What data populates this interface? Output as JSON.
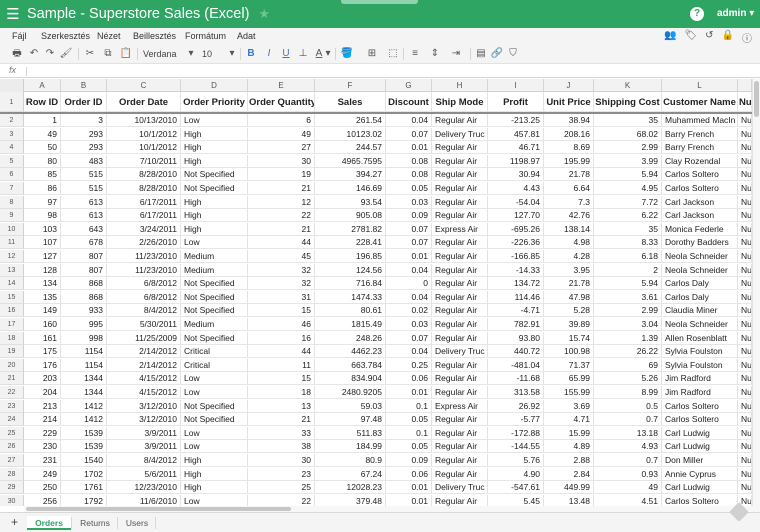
{
  "app": {
    "title": "Sample - Superstore Sales (Excel)",
    "user": "admin",
    "user_suffix": "▾",
    "accent_color": "#2fa564",
    "icons": {
      "menu": "☰",
      "star": "★",
      "help": "?"
    }
  },
  "menubar": {
    "items": [
      "Fájl",
      "Szerkesztés",
      "Nézet",
      "Beillesztés",
      "Formátum",
      "Adat"
    ],
    "right_icons": [
      "users-icon",
      "tag-icon",
      "history-icon",
      "lock-icon",
      "info-icon"
    ],
    "right_glyphs": [
      "👥",
      "🏷",
      "↺",
      "🔒",
      "ⓘ"
    ]
  },
  "toolbar": {
    "icons": {
      "print": "🖶",
      "undo": "↶",
      "redo": "↷",
      "paint_format": "🖌",
      "cut": "✂",
      "copy": "⧉",
      "paste": "📋",
      "font_color": "A",
      "fill_color": "🪣",
      "borders": "⊞",
      "merge": "⬚",
      "align": "≡",
      "valign": "⇕",
      "wrap": "⇥",
      "comment": "▤",
      "link": "🔗",
      "filter": "⛉"
    },
    "font_family": "Verdana",
    "font_size": "10",
    "dropdown_arrow": "▾",
    "bold_label": "B",
    "italic_label": "I",
    "underline_label": "U"
  },
  "formula_bar": {
    "label": "fx",
    "value": ""
  },
  "column_letters": [
    "A",
    "B",
    "C",
    "D",
    "E",
    "F",
    "G",
    "H",
    "I",
    "J",
    "K",
    "L"
  ],
  "table": {
    "headers": [
      "Row ID",
      "Order ID",
      "Order Date",
      "Order Priority",
      "Order Quantity",
      "Sales",
      "Discount",
      "Ship Mode",
      "Profit",
      "Unit Price",
      "Shipping Cost",
      "Customer Name",
      "Nu"
    ],
    "rows": [
      [
        "1",
        "3",
        "10/13/2010",
        "Low",
        "6",
        "261.54",
        "0.04",
        "Regular Air",
        "-213.25",
        "38.94",
        "35",
        "Muhammed MacIn",
        "Nu"
      ],
      [
        "49",
        "293",
        "10/1/2012",
        "High",
        "49",
        "10123.02",
        "0.07",
        "Delivery Truc",
        "457.81",
        "208.16",
        "68.02",
        "Barry French",
        "Nu"
      ],
      [
        "50",
        "293",
        "10/1/2012",
        "High",
        "27",
        "244.57",
        "0.01",
        "Regular Air",
        "46.71",
        "8.69",
        "2.99",
        "Barry French",
        "Nu"
      ],
      [
        "80",
        "483",
        "7/10/2011",
        "High",
        "30",
        "4965.7595",
        "0.08",
        "Regular Air",
        "1198.97",
        "195.99",
        "3.99",
        "Clay Rozendal",
        "Nu"
      ],
      [
        "85",
        "515",
        "8/28/2010",
        "Not Specified",
        "19",
        "394.27",
        "0.08",
        "Regular Air",
        "30.94",
        "21.78",
        "5.94",
        "Carlos Soltero",
        "Nu"
      ],
      [
        "86",
        "515",
        "8/28/2010",
        "Not Specified",
        "21",
        "146.69",
        "0.05",
        "Regular Air",
        "4.43",
        "6.64",
        "4.95",
        "Carlos Soltero",
        "Nu"
      ],
      [
        "97",
        "613",
        "6/17/2011",
        "High",
        "12",
        "93.54",
        "0.03",
        "Regular Air",
        "-54.04",
        "7.3",
        "7.72",
        "Carl Jackson",
        "Nu"
      ],
      [
        "98",
        "613",
        "6/17/2011",
        "High",
        "22",
        "905.08",
        "0.09",
        "Regular Air",
        "127.70",
        "42.76",
        "6.22",
        "Carl Jackson",
        "Nu"
      ],
      [
        "103",
        "643",
        "3/24/2011",
        "High",
        "21",
        "2781.82",
        "0.07",
        "Express Air",
        "-695.26",
        "138.14",
        "35",
        "Monica Federle",
        "Nu"
      ],
      [
        "107",
        "678",
        "2/26/2010",
        "Low",
        "44",
        "228.41",
        "0.07",
        "Regular Air",
        "-226.36",
        "4.98",
        "8.33",
        "Dorothy Badders",
        "Nu"
      ],
      [
        "127",
        "807",
        "11/23/2010",
        "Medium",
        "45",
        "196.85",
        "0.01",
        "Regular Air",
        "-166.85",
        "4.28",
        "6.18",
        "Neola Schneider",
        "Nu"
      ],
      [
        "128",
        "807",
        "11/23/2010",
        "Medium",
        "32",
        "124.56",
        "0.04",
        "Regular Air",
        "-14.33",
        "3.95",
        "2",
        "Neola Schneider",
        "Nu"
      ],
      [
        "134",
        "868",
        "6/8/2012",
        "Not Specified",
        "32",
        "716.84",
        "0",
        "Regular Air",
        "134.72",
        "21.78",
        "5.94",
        "Carlos Daly",
        "Nu"
      ],
      [
        "135",
        "868",
        "6/8/2012",
        "Not Specified",
        "31",
        "1474.33",
        "0.04",
        "Regular Air",
        "114.46",
        "47.98",
        "3.61",
        "Carlos Daly",
        "Nu"
      ],
      [
        "149",
        "933",
        "8/4/2012",
        "Not Specified",
        "15",
        "80.61",
        "0.02",
        "Regular Air",
        "-4.71",
        "5.28",
        "2.99",
        "Claudia Miner",
        "Nu"
      ],
      [
        "160",
        "995",
        "5/30/2011",
        "Medium",
        "46",
        "1815.49",
        "0.03",
        "Regular Air",
        "782.91",
        "39.89",
        "3.04",
        "Neola Schneider",
        "Nu"
      ],
      [
        "161",
        "998",
        "11/25/2009",
        "Not Specified",
        "16",
        "248.26",
        "0.07",
        "Regular Air",
        "93.80",
        "15.74",
        "1.39",
        "Allen Rosenblatt",
        "Nu"
      ],
      [
        "175",
        "1154",
        "2/14/2012",
        "Critical",
        "44",
        "4462.23",
        "0.04",
        "Delivery Truc",
        "440.72",
        "100.98",
        "26.22",
        "Sylvia Foulston",
        "Nu"
      ],
      [
        "176",
        "1154",
        "2/14/2012",
        "Critical",
        "11",
        "663.784",
        "0.25",
        "Regular Air",
        "-481.04",
        "71.37",
        "69",
        "Sylvia Foulston",
        "Nu"
      ],
      [
        "203",
        "1344",
        "4/15/2012",
        "Low",
        "15",
        "834.904",
        "0.06",
        "Regular Air",
        "-11.68",
        "65.99",
        "5.26",
        "Jim Radford",
        "Nu"
      ],
      [
        "204",
        "1344",
        "4/15/2012",
        "Low",
        "18",
        "2480.9205",
        "0.01",
        "Regular Air",
        "313.58",
        "155.99",
        "8.99",
        "Jim Radford",
        "Nu"
      ],
      [
        "213",
        "1412",
        "3/12/2010",
        "Not Specified",
        "13",
        "59.03",
        "0.1",
        "Express Air",
        "26.92",
        "3.69",
        "0.5",
        "Carlos Soltero",
        "Nu"
      ],
      [
        "214",
        "1412",
        "3/12/2010",
        "Not Specified",
        "21",
        "97.48",
        "0.05",
        "Regular Air",
        "-5.77",
        "4.71",
        "0.7",
        "Carlos Soltero",
        "Nu"
      ],
      [
        "229",
        "1539",
        "3/9/2011",
        "Low",
        "33",
        "511.83",
        "0.1",
        "Regular Air",
        "-172.88",
        "15.99",
        "13.18",
        "Carl Ludwig",
        "Nu"
      ],
      [
        "230",
        "1539",
        "3/9/2011",
        "Low",
        "38",
        "184.99",
        "0.05",
        "Regular Air",
        "-144.55",
        "4.89",
        "4.93",
        "Carl Ludwig",
        "Nu"
      ],
      [
        "231",
        "1540",
        "8/4/2012",
        "High",
        "30",
        "80.9",
        "0.09",
        "Regular Air",
        "5.76",
        "2.88",
        "0.7",
        "Don Miller",
        "Nu"
      ],
      [
        "249",
        "1702",
        "5/6/2011",
        "High",
        "23",
        "67.24",
        "0.06",
        "Regular Air",
        "4.90",
        "2.84",
        "0.93",
        "Annie Cyprus",
        "Nu"
      ],
      [
        "250",
        "1761",
        "12/23/2010",
        "High",
        "25",
        "12028.23",
        "0.01",
        "Delivery Truc",
        "-547.61",
        "449.99",
        "49",
        "Carl Ludwig",
        "Nu"
      ],
      [
        "256",
        "1792",
        "11/6/2010",
        "Low",
        "22",
        "379.48",
        "0.01",
        "Regular Air",
        "5.45",
        "13.48",
        "4.51",
        "Carlos Soltero",
        "Nu"
      ]
    ]
  },
  "sheets": {
    "add_label": "+",
    "tabs": [
      "Orders",
      "Returns",
      "Users"
    ],
    "active": "Orders"
  }
}
